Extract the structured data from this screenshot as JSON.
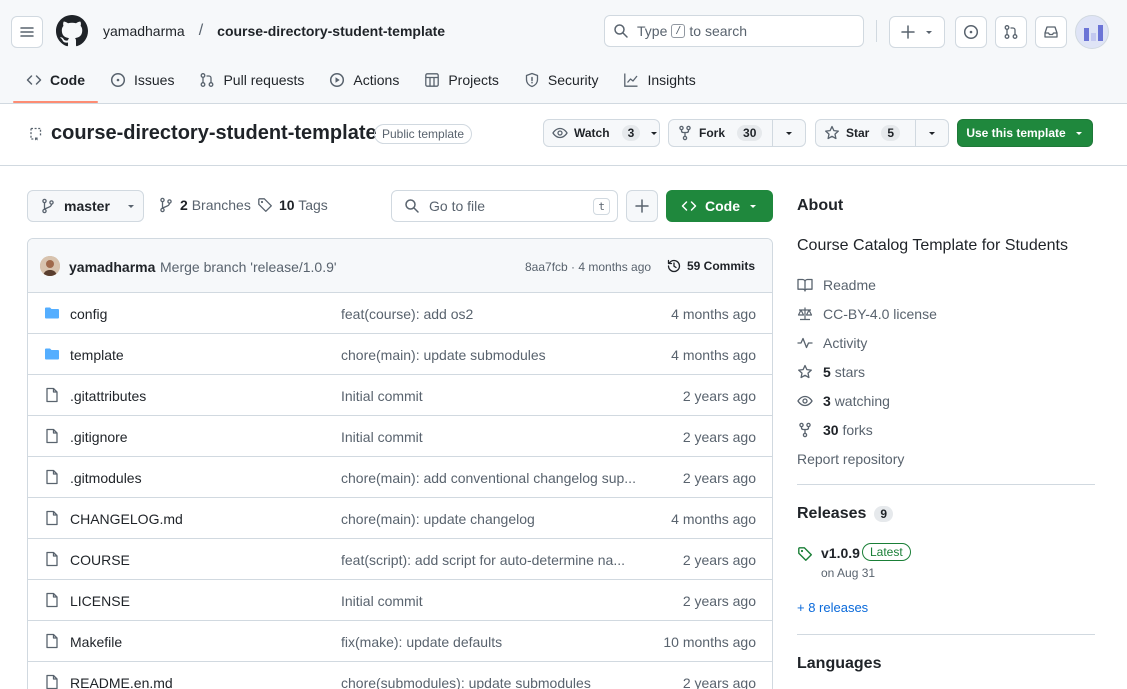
{
  "header": {
    "owner": "yamadharma",
    "separator": "/",
    "repo": "course-directory-student-template",
    "search": {
      "prefix": "Type",
      "key": "/",
      "suffix": "to search"
    }
  },
  "tabs": [
    {
      "label": "Code",
      "icon": "code-icon"
    },
    {
      "label": "Issues",
      "icon": "issue-icon"
    },
    {
      "label": "Pull requests",
      "icon": "pull-request-icon"
    },
    {
      "label": "Actions",
      "icon": "play-icon"
    },
    {
      "label": "Projects",
      "icon": "table-icon"
    },
    {
      "label": "Security",
      "icon": "shield-icon"
    },
    {
      "label": "Insights",
      "icon": "graph-icon"
    }
  ],
  "repo_header": {
    "title": "course-directory-student-template",
    "badge": "Public template",
    "watch": {
      "label": "Watch",
      "count": "3"
    },
    "fork": {
      "label": "Fork",
      "count": "30"
    },
    "star": {
      "label": "Star",
      "count": "5"
    },
    "use_template": "Use this template"
  },
  "file_nav": {
    "branch": "master",
    "branches_count": "2",
    "branches_label": "Branches",
    "tags_count": "10",
    "tags_label": "Tags",
    "goto_placeholder": "Go to file",
    "goto_key": "t",
    "code_label": "Code"
  },
  "latest_commit": {
    "author": "yamadharma",
    "message": "Merge branch 'release/1.0.9'",
    "meta": "8aa7fcb · 4 months ago",
    "commits": "59 Commits"
  },
  "files": [
    {
      "name": "config",
      "type": "dir",
      "message": "feat(course): add os2",
      "date": "4 months ago"
    },
    {
      "name": "template",
      "type": "dir",
      "message": "chore(main): update submodules",
      "date": "4 months ago"
    },
    {
      "name": ".gitattributes",
      "type": "file",
      "message": "Initial commit",
      "date": "2 years ago"
    },
    {
      "name": ".gitignore",
      "type": "file",
      "message": "Initial commit",
      "date": "2 years ago"
    },
    {
      "name": ".gitmodules",
      "type": "file",
      "message": "chore(main): add conventional changelog sup...",
      "date": "2 years ago"
    },
    {
      "name": "CHANGELOG.md",
      "type": "file",
      "message": "chore(main): update changelog",
      "date": "4 months ago"
    },
    {
      "name": "COURSE",
      "type": "file",
      "message": "feat(script): add script for auto-determine na...",
      "date": "2 years ago"
    },
    {
      "name": "LICENSE",
      "type": "file",
      "message": "Initial commit",
      "date": "2 years ago"
    },
    {
      "name": "Makefile",
      "type": "file",
      "message": "fix(make): update defaults",
      "date": "10 months ago"
    },
    {
      "name": "README.en.md",
      "type": "file",
      "message": "chore(submodules): update submodules",
      "date": "2 years ago"
    }
  ],
  "about": {
    "heading": "About",
    "description": "Course Catalog Template for Students",
    "readme": "Readme",
    "license": "CC-BY-4.0 license",
    "activity": "Activity",
    "stars_count": "5",
    "stars_label": "stars",
    "watching_count": "3",
    "watching_label": "watching",
    "forks_count": "30",
    "forks_label": "forks",
    "report": "Report repository"
  },
  "releases": {
    "heading": "Releases",
    "count": "9",
    "version": "v1.0.9",
    "badge": "Latest",
    "date": "on Aug 31",
    "more": "+ 8 releases"
  },
  "languages": {
    "heading": "Languages"
  },
  "colors": {
    "green": "#1f883d",
    "accent_tab": "#fd8c73",
    "link": "#0969da",
    "folder": "#54aeff"
  }
}
